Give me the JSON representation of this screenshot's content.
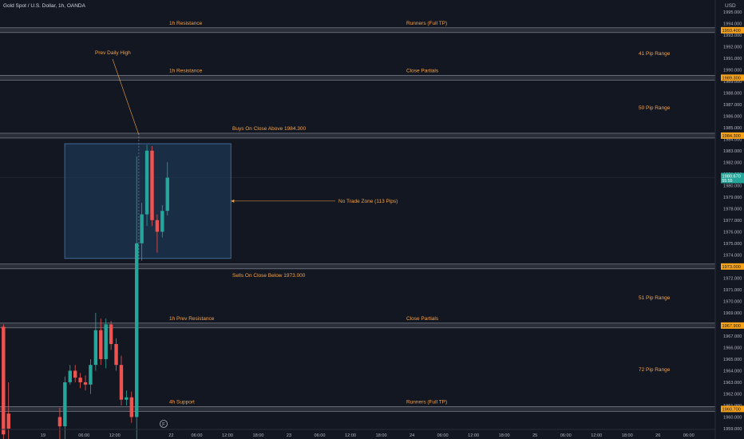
{
  "header": {
    "symbol_title": "Gold Spot / U.S. Dollar, 1h, OANDA",
    "currency": "USD",
    "logo_label": "F"
  },
  "colors": {
    "background": "#131722",
    "grid": "#1e222d",
    "axis_text": "#b2b5be",
    "annotation": "#f0a24a",
    "zone_stroke": "#f0a24a",
    "level_fill": "#2a2e39",
    "level_edge": "#8a8f9a",
    "tag_orange": "#f7a21b",
    "tag_teal": "#26a69a",
    "no_trade_fill": "#1c3550",
    "no_trade_stroke": "#3d6a99",
    "candle_up": "#26a69a",
    "candle_down": "#ef5350"
  },
  "chart_data": {
    "type": "candlestick",
    "title": "Gold Spot / U.S. Dollar, 1h, OANDA",
    "ylim": [
      1959.0,
      1996.0
    ],
    "y_ticks": [
      1959,
      1960,
      1961,
      1962,
      1963,
      1964,
      1965,
      1966,
      1967,
      1968,
      1969,
      1970,
      1971,
      1972,
      1973,
      1974,
      1975,
      1976,
      1977,
      1978,
      1979,
      1980,
      1981,
      1982,
      1983,
      1984,
      1985,
      1986,
      1987,
      1988,
      1989,
      1990,
      1991,
      1992,
      1993,
      1994,
      1995,
      1996
    ],
    "x_ticks": [
      "19",
      "06:00",
      "12:00",
      "22",
      "06:00",
      "12:00",
      "18:00",
      "23",
      "06:00",
      "12:00",
      "18:00",
      "24",
      "06:00",
      "12:00",
      "18:00",
      "25",
      "06:00",
      "12:00",
      "18:00",
      "26",
      "06:00"
    ],
    "x_tick_index": [
      8,
      16,
      22,
      33,
      38,
      44,
      50,
      56,
      62,
      68,
      74,
      80,
      86,
      92,
      98,
      104,
      110,
      116,
      122,
      128,
      134
    ],
    "x_domain": [
      0,
      138
    ],
    "last_price": {
      "value": "1980.670",
      "countdown": "55:55"
    },
    "candles": [
      {
        "i": 0,
        "o": 1967.8,
        "h": 1968.0,
        "l": 1958.0,
        "c": 1958.5
      },
      {
        "i": 1,
        "o": 1960.3,
        "h": 1963.0,
        "l": 1958.0,
        "c": 1959.0
      },
      {
        "i": 11,
        "o": 1960.0,
        "h": 1960.8,
        "l": 1958.0,
        "c": 1959.2
      },
      {
        "i": 12,
        "o": 1959.2,
        "h": 1963.5,
        "l": 1958.0,
        "c": 1963.0
      },
      {
        "i": 13,
        "o": 1963.0,
        "h": 1964.5,
        "l": 1962.8,
        "c": 1964.0
      },
      {
        "i": 14,
        "o": 1964.0,
        "h": 1964.5,
        "l": 1963.0,
        "c": 1963.4
      },
      {
        "i": 15,
        "o": 1963.4,
        "h": 1963.8,
        "l": 1962.5,
        "c": 1963.0
      },
      {
        "i": 16,
        "o": 1963.0,
        "h": 1963.6,
        "l": 1962.3,
        "c": 1962.8
      },
      {
        "i": 17,
        "o": 1962.8,
        "h": 1965.0,
        "l": 1962.0,
        "c": 1964.5
      },
      {
        "i": 18,
        "o": 1964.5,
        "h": 1969.0,
        "l": 1964.0,
        "c": 1967.5
      },
      {
        "i": 19,
        "o": 1967.5,
        "h": 1968.5,
        "l": 1964.5,
        "c": 1965.0
      },
      {
        "i": 20,
        "o": 1965.0,
        "h": 1968.5,
        "l": 1964.2,
        "c": 1968.0
      },
      {
        "i": 21,
        "o": 1968.0,
        "h": 1968.3,
        "l": 1965.8,
        "c": 1966.3
      },
      {
        "i": 22,
        "o": 1966.3,
        "h": 1966.8,
        "l": 1964.0,
        "c": 1964.5
      },
      {
        "i": 23,
        "o": 1964.5,
        "h": 1965.3,
        "l": 1961.0,
        "c": 1961.5
      },
      {
        "i": 24,
        "o": 1961.5,
        "h": 1962.3,
        "l": 1961.0,
        "c": 1961.7
      },
      {
        "i": 25,
        "o": 1961.7,
        "h": 1962.2,
        "l": 1959.5,
        "c": 1960.0
      },
      {
        "i": 26,
        "o": 1960.0,
        "h": 1982.5,
        "l": 1958.0,
        "c": 1975.0
      },
      {
        "i": 27,
        "o": 1975.0,
        "h": 1978.5,
        "l": 1973.5,
        "c": 1977.5
      },
      {
        "i": 28,
        "o": 1977.5,
        "h": 1983.5,
        "l": 1976.5,
        "c": 1983.0
      },
      {
        "i": 29,
        "o": 1983.0,
        "h": 1983.4,
        "l": 1976.5,
        "c": 1977.0
      },
      {
        "i": 30,
        "o": 1977.0,
        "h": 1977.5,
        "l": 1974.2,
        "c": 1976.0
      },
      {
        "i": 31,
        "o": 1976.0,
        "h": 1978.3,
        "l": 1975.5,
        "c": 1977.8
      },
      {
        "i": 32,
        "o": 1977.8,
        "h": 1982.0,
        "l": 1977.4,
        "c": 1980.67
      }
    ],
    "levels": [
      {
        "value": 1993.4,
        "tag": "1993.400",
        "left_label": "1h Resistance",
        "mid_label": "Runners (Full TP)",
        "tag_color": "orange"
      },
      {
        "value": 1989.3,
        "tag": "1989.300",
        "left_label": "1h Resistance",
        "mid_label": "Close Partials",
        "tag_color": "orange"
      },
      {
        "value": 1984.3,
        "tag": "1984.300",
        "left_label": "",
        "mid_label": "Buys On Close Above 1984.300",
        "tag_color": "orange"
      },
      {
        "value": 1973.0,
        "tag": "1973.000",
        "left_label": "",
        "mid_label": "Sells On Close Below 1973.000",
        "tag_color": "orange"
      },
      {
        "value": 1967.9,
        "tag": "1967.900",
        "left_label": "1h Prev Resistance",
        "mid_label": "Close Partials",
        "tag_color": "orange"
      },
      {
        "value": 1960.7,
        "tag": "1960.700",
        "left_label": "4h Support",
        "mid_label": "Runners (Full TP)",
        "tag_color": "orange"
      }
    ],
    "range_labels": [
      {
        "text": "41 Pip Range",
        "y": 1991.4
      },
      {
        "text": "50 Pip Range",
        "y": 1986.7
      },
      {
        "text": "51 Pip Range",
        "y": 1970.3
      },
      {
        "text": "72 Pip Range",
        "y": 1964.1
      }
    ],
    "no_trade_zone": {
      "x0": 11,
      "x1": 40,
      "y_top": 1983.6,
      "y_bottom": 1973.7,
      "label": "No Trade Zone (113 Pips)"
    },
    "prev_daily_high": {
      "label": "Prev Daily High",
      "value": 1984.3,
      "at_index": 26.7
    }
  }
}
